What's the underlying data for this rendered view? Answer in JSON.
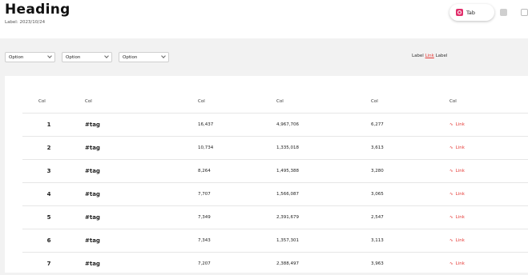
{
  "header": {
    "title": "Heading",
    "last_updated": "Label: 2023/10/24"
  },
  "platform_tab": {
    "label": "Tab"
  },
  "filters": {
    "country": "Option",
    "period": "Option",
    "category": "Option"
  },
  "feedback": {
    "prompt": "Label",
    "link": "Link",
    "suffix": "Label"
  },
  "table": {
    "headers": {
      "rank": "Col",
      "hashtag": "Col",
      "mentions": "Col",
      "engagement": "Col",
      "influencers": "Col",
      "action": "Col"
    },
    "action_label": "Link",
    "rows": [
      {
        "rank": "1",
        "hashtag": "#tag",
        "mentions": "16,437",
        "engagement": "4,967,706",
        "influencers": "6,277"
      },
      {
        "rank": "2",
        "hashtag": "#tag",
        "mentions": "10,734",
        "engagement": "1,335,018",
        "influencers": "3,613"
      },
      {
        "rank": "3",
        "hashtag": "#tag",
        "mentions": "8,264",
        "engagement": "1,495,388",
        "influencers": "3,280"
      },
      {
        "rank": "4",
        "hashtag": "#tag",
        "mentions": "7,707",
        "engagement": "1,566,087",
        "influencers": "3,065"
      },
      {
        "rank": "5",
        "hashtag": "#tag",
        "mentions": "7,349",
        "engagement": "2,391,679",
        "influencers": "2,547"
      },
      {
        "rank": "6",
        "hashtag": "#tag",
        "mentions": "7,343",
        "engagement": "1,357,301",
        "influencers": "3,113"
      },
      {
        "rank": "7",
        "hashtag": "#tag",
        "mentions": "7,207",
        "engagement": "2,388,497",
        "influencers": "3,963"
      }
    ]
  }
}
